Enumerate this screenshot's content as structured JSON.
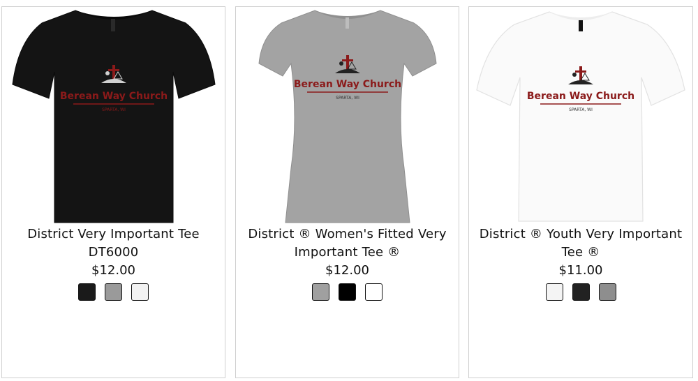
{
  "products": [
    {
      "title_line1": "District Very Important Tee",
      "title_line2": "DT6000",
      "price": "$12.00",
      "shirt_color": "#141414",
      "logo_line1": "Berean Way Church",
      "logo_line2": "SPARTA, WI",
      "swatches": [
        "#1a1a1a",
        "#9a9a9a",
        "#f2f2f2"
      ]
    },
    {
      "title_line1": "District ® Women's Fitted Very",
      "title_line2": "Important Tee ®",
      "price": "$12.00",
      "shirt_color": "#a3a3a3",
      "logo_line1": "Berean Way Church",
      "logo_line2": "SPARTA, WI",
      "swatches": [
        "#a0a0a0",
        "#000000",
        "#ffffff"
      ]
    },
    {
      "title_line1": "District ® Youth Very Important",
      "title_line2": "Tee ®",
      "price": "$11.00",
      "shirt_color": "#fafafa",
      "logo_line1": "Berean Way Church",
      "logo_line2": "SPARTA, WI",
      "swatches": [
        "#f4f4f4",
        "#222222",
        "#8e8e8e"
      ]
    }
  ],
  "brand_colors": {
    "logo_red": "#8b1a1a",
    "logo_dark": "#222222"
  }
}
